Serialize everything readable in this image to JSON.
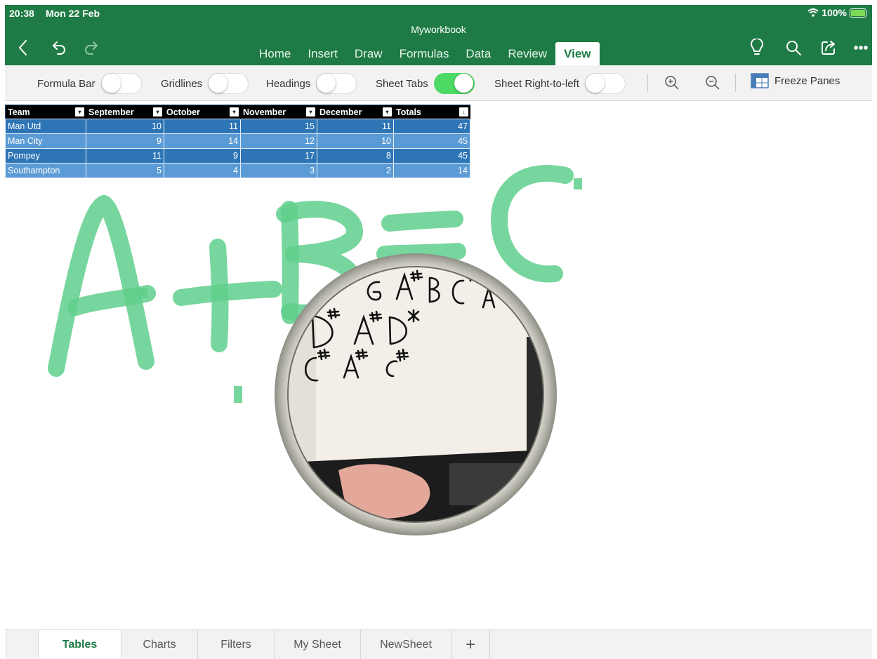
{
  "status_bar": {
    "time": "20:38",
    "date": "Mon 22 Feb",
    "battery": "100%"
  },
  "app": {
    "document_title": "Myworkbook"
  },
  "ribbon": {
    "tabs": [
      {
        "label": "Home"
      },
      {
        "label": "Insert"
      },
      {
        "label": "Draw"
      },
      {
        "label": "Formulas"
      },
      {
        "label": "Data"
      },
      {
        "label": "Review"
      },
      {
        "label": "View",
        "active": true
      }
    ]
  },
  "toolbar": {
    "formula_bar": {
      "label": "Formula Bar",
      "on": false
    },
    "gridlines": {
      "label": "Gridlines",
      "on": false
    },
    "headings": {
      "label": "Headings",
      "on": false
    },
    "sheet_tabs": {
      "label": "Sheet Tabs",
      "on": true
    },
    "sheet_rtl": {
      "label": "Sheet Right-to-left",
      "on": false
    },
    "freeze_panes": "Freeze Panes"
  },
  "table": {
    "headers": [
      "Team",
      "September",
      "October",
      "November",
      "December",
      "Totals"
    ],
    "rows": [
      [
        "Man Utd",
        "10",
        "11",
        "15",
        "11",
        "47"
      ],
      [
        "Man City",
        "9",
        "14",
        "12",
        "10",
        "45"
      ],
      [
        "Pompey",
        "11",
        "9",
        "17",
        "8",
        "45"
      ],
      [
        "Southampton",
        "5",
        "4",
        "3",
        "2",
        "14"
      ]
    ]
  },
  "ink": {
    "color": "#5fcf8c",
    "magnifier_content": "camera view of hand-written musical notes on a whiteboard"
  },
  "sheet_tabs": [
    {
      "label": "Tables",
      "active": true
    },
    {
      "label": "Charts"
    },
    {
      "label": "Filters"
    },
    {
      "label": "My Sheet"
    },
    {
      "label": "NewSheet"
    }
  ],
  "add_sheet_label": "+",
  "colors": {
    "brand_green": "#1e7b45",
    "toggle_on": "#4cd964",
    "table_blue": "#2e75b6"
  }
}
